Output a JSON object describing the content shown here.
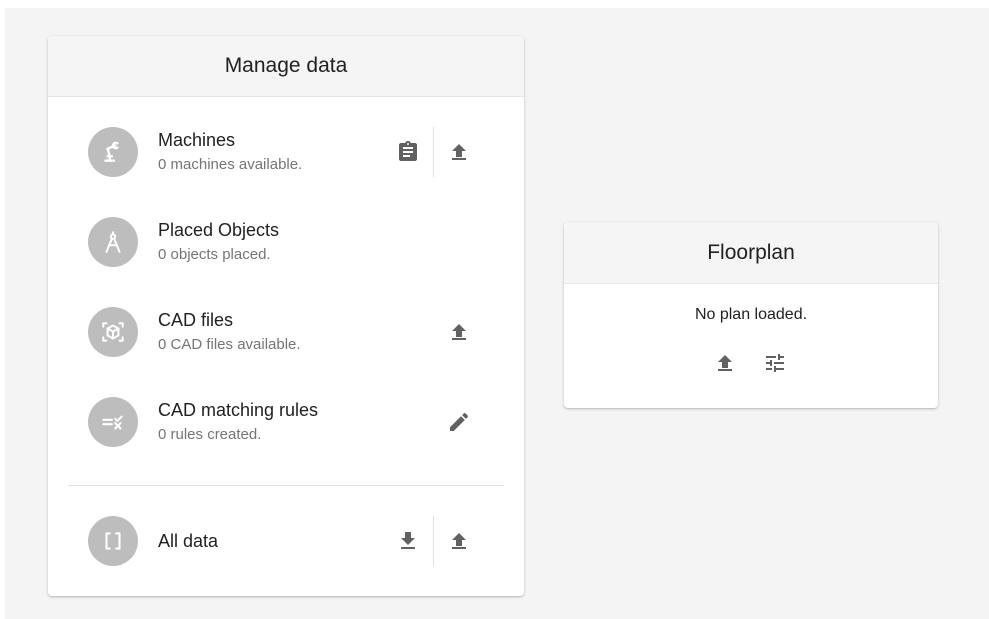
{
  "manage": {
    "title": "Manage data",
    "items": [
      {
        "title": "Machines",
        "subtitle": "0 machines available."
      },
      {
        "title": "Placed Objects",
        "subtitle": "0 objects placed."
      },
      {
        "title": "CAD files",
        "subtitle": "0 CAD files available."
      },
      {
        "title": "CAD matching rules",
        "subtitle": "0 rules created."
      },
      {
        "title": "All data",
        "subtitle": ""
      }
    ],
    "icons": {
      "machines": "robot-arm-icon",
      "placed_objects": "compass-icon",
      "cad_files": "cube-scan-icon",
      "cad_rules": "rules-check-icon",
      "all_data": "brackets-icon"
    }
  },
  "floorplan": {
    "title": "Floorplan",
    "message": "No plan loaded."
  },
  "colors": {
    "avatar_bg": "#bdbdbd",
    "icon_gray": "#616161",
    "header_bg": "#f5f5f5",
    "page_bg": "#f4f4f4"
  }
}
